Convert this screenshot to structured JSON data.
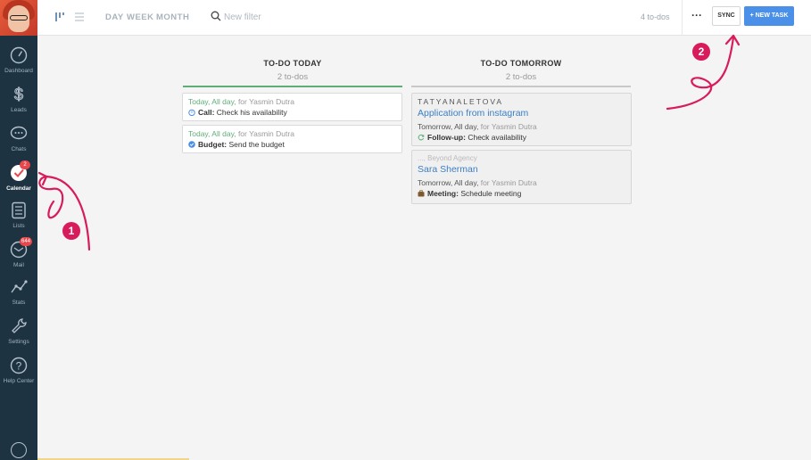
{
  "sidebar": {
    "items": [
      {
        "label": "Dashboard",
        "icon": "dashboard-icon"
      },
      {
        "label": "Leads",
        "icon": "dollar-icon"
      },
      {
        "label": "Chats",
        "icon": "chat-icon"
      },
      {
        "label": "Calendar",
        "icon": "check-icon",
        "badge": "2",
        "active": true
      },
      {
        "label": "Lists",
        "icon": "list-icon"
      },
      {
        "label": "Mail",
        "icon": "mail-icon",
        "badge": "644"
      },
      {
        "label": "Stats",
        "icon": "stats-icon"
      },
      {
        "label": "Settings",
        "icon": "wrench-icon"
      },
      {
        "label": "Help Center",
        "icon": "help-icon"
      }
    ]
  },
  "topbar": {
    "periods": [
      "DAY",
      "WEEK",
      "MONTH"
    ],
    "filter_placeholder": "New filter",
    "todo_count": "4 to-dos",
    "more_label": "···",
    "sync_label": "SYNC",
    "new_task_label": "+ NEW TASK"
  },
  "colors": {
    "accent": "#4a8fe8",
    "today_line": "#5fae78",
    "tomorrow_line": "#c8c8c8",
    "annotation": "#d81b5a",
    "sidebar": "#1e3341"
  },
  "columns": {
    "today": {
      "title": "TO-DO TODAY",
      "subtitle": "2 to-dos",
      "cards": [
        {
          "when": "Today, All day,",
          "for_text": "for Yasmin Dutra",
          "type": "Call:",
          "text": "Check his availability",
          "icon": "alarm-icon"
        },
        {
          "when": "Today, All day,",
          "for_text": "for Yasmin Dutra",
          "type": "Budget:",
          "text": "Send the budget",
          "icon": "check-circle-icon"
        }
      ]
    },
    "tomorrow": {
      "title": "TO-DO TOMORROW",
      "subtitle": "2 to-dos",
      "cards": [
        {
          "company": "TATYANALETOVA",
          "lead": "Application from instagram",
          "when": "Tomorrow, All day,",
          "for_text": "for Yasmin Dutra",
          "type": "Follow-up:",
          "text": "Check availability",
          "icon": "refresh-icon"
        },
        {
          "company": "..., Beyond Agency",
          "lead": "Sara Sherman",
          "when": "Tomorrow, All day,",
          "for_text": "for Yasmin Dutra",
          "type": "Meeting:",
          "text": "Schedule meeting",
          "icon": "briefcase-icon"
        }
      ]
    }
  },
  "annotations": {
    "one": "1",
    "two": "2"
  }
}
